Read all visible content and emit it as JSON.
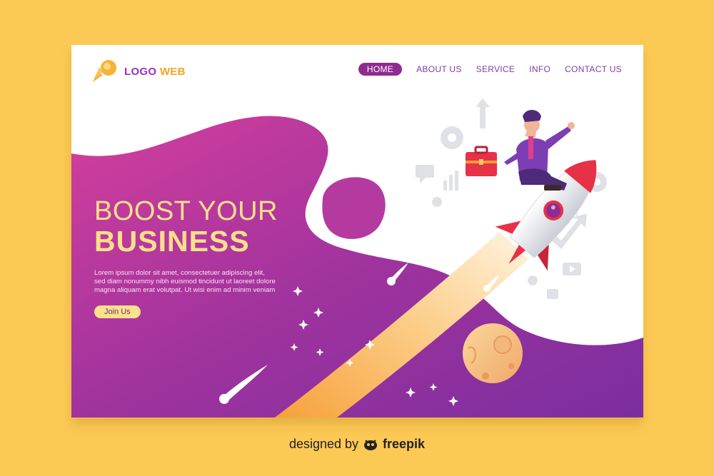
{
  "logo": {
    "text": "LOGO WEB",
    "icon": "rocket-comet-icon"
  },
  "nav": {
    "items": [
      {
        "label": "HOME",
        "active": true
      },
      {
        "label": "ABOUT US",
        "active": false
      },
      {
        "label": "SERVICE",
        "active": false
      },
      {
        "label": "INFO",
        "active": false
      },
      {
        "label": "CONTACT US",
        "active": false
      }
    ]
  },
  "hero": {
    "title_line1": "BOOST YOUR",
    "title_line2": "BUSINESS",
    "body": "Lorem ipsum dolor sit amet, consectetuer adipiscing elit, sed diam nonummy nibh euismod tincidunt ut laoreet dolore magna aliquam erat volutpat. Ut wisi enim ad minim veniam",
    "cta_label": "Join Us"
  },
  "illustration": {
    "subject": "businessman riding rocket",
    "icons": [
      "gear-icon",
      "arrow-up-icon",
      "chat-icon",
      "bar-chart-icon",
      "percent-icon",
      "play-icon",
      "thumbs-up-icon",
      "trend-arrow-icon",
      "briefcase-icon",
      "planet-icon"
    ]
  },
  "credit": {
    "prefix": "designed by",
    "brand": "freepik"
  },
  "colors": {
    "page_bg": "#fdc955",
    "purple": "#8f2b90",
    "magenta": "#cc3c9e",
    "accent_yellow": "#fde08a",
    "rocket_red": "#e63247"
  }
}
